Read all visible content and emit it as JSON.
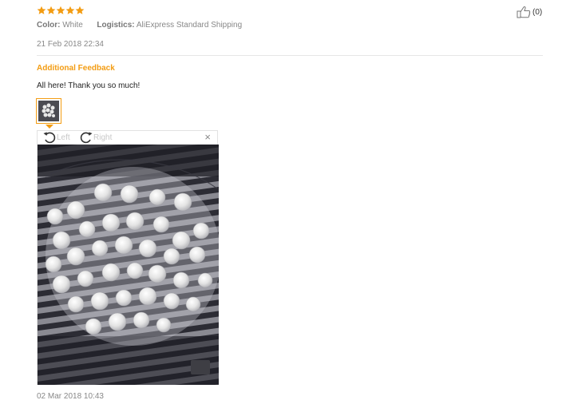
{
  "review": {
    "rating": 5,
    "color_label": "Color:",
    "color_value": "White",
    "logistics_label": "Logistics:",
    "logistics_value": "AliExpress Standard Shipping",
    "date": "21 Feb 2018 22:34",
    "helpful_count": "(0)",
    "accent_color": "#f39c12"
  },
  "additional": {
    "heading": "Additional Feedback",
    "text": "All here! Thank you so much!",
    "date": "02 Mar 2018 10:43"
  },
  "viewer": {
    "rotate_left_label": "Left",
    "rotate_right_label": "Right",
    "close_label": "×"
  },
  "icons": {
    "star": "star-icon",
    "thumbs_up": "thumbs-up-icon",
    "rotate_left": "rotate-left-icon",
    "rotate_right": "rotate-right-icon",
    "close": "close-icon"
  }
}
